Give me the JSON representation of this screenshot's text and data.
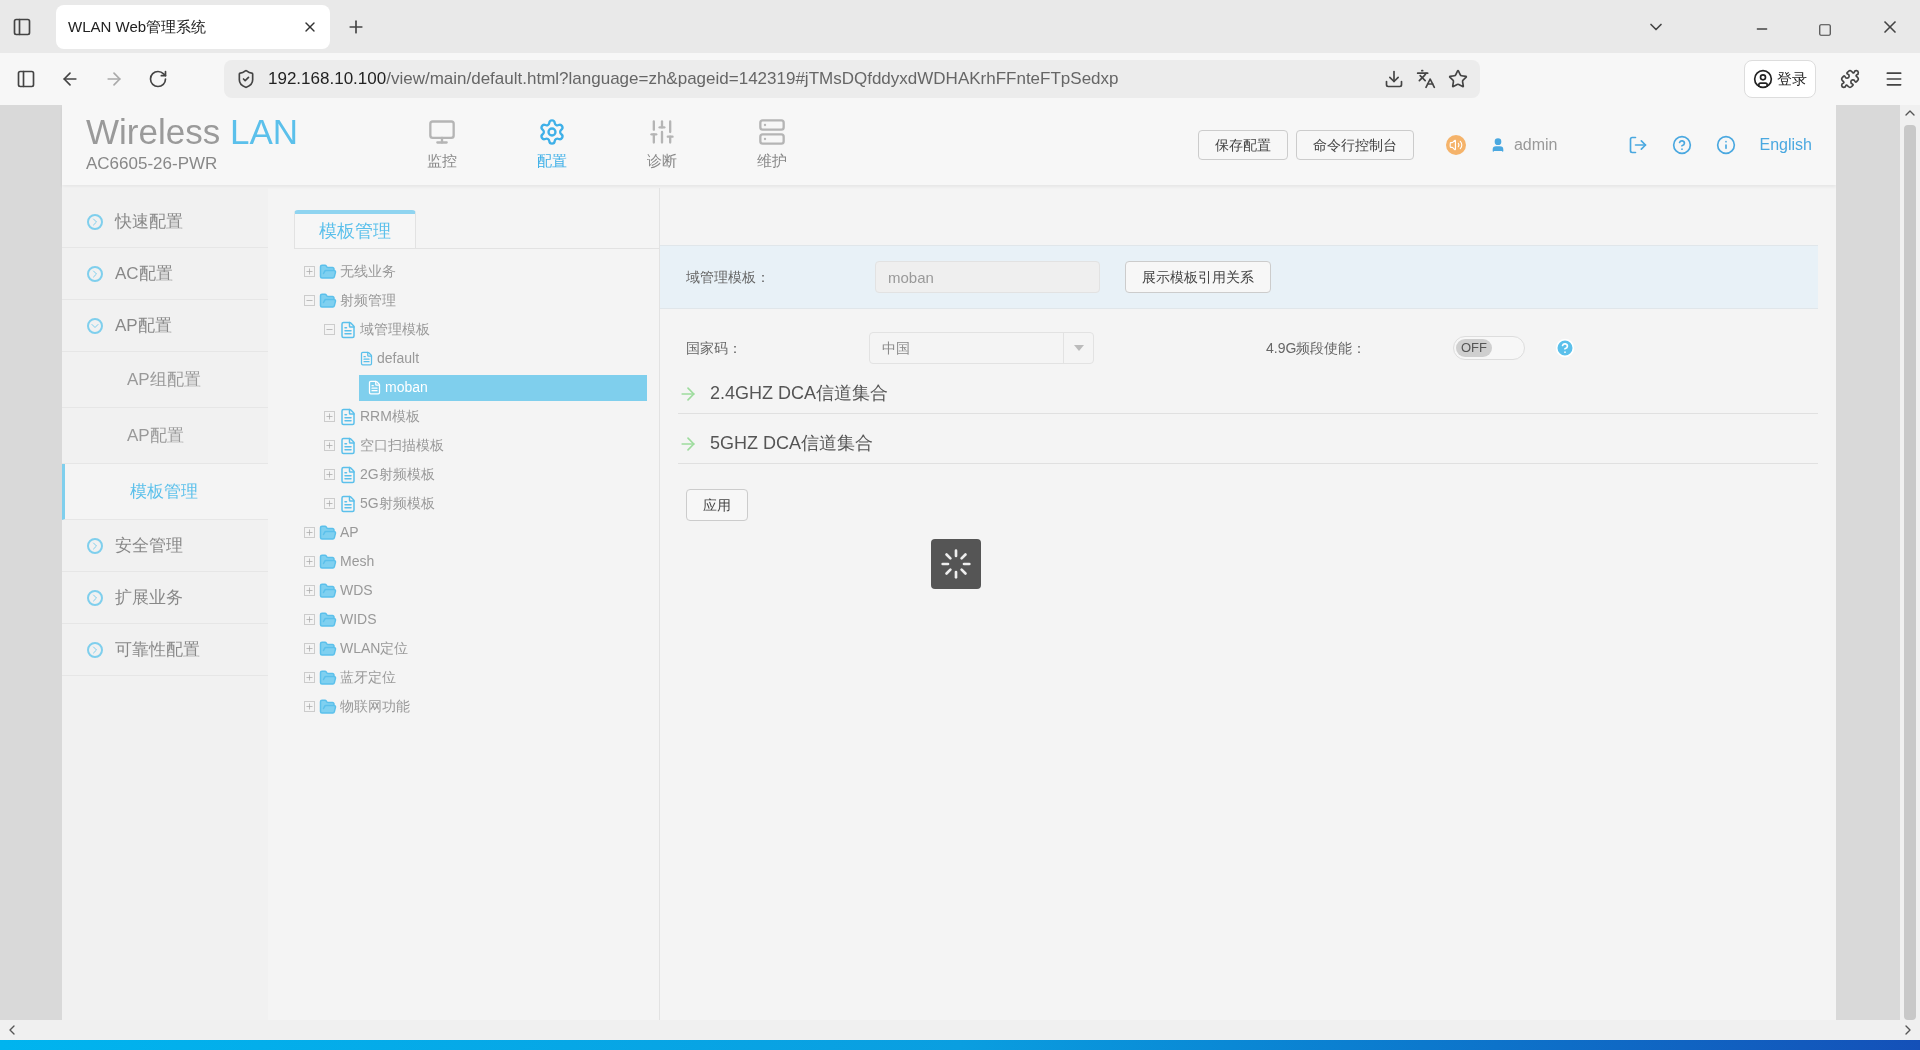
{
  "browser": {
    "tab_title": "WLAN Web管理系统",
    "url_host": "192.168.10.100",
    "url_rest": "/view/main/default.html?language=zh&pageid=142319#jTMsDQfddyxdWDHAKrhFFnteFTpSedxp",
    "sign_in": "登录"
  },
  "header": {
    "brand_first": "Wireless",
    "brand_second": "LAN",
    "model": "AC6605-26-PWR",
    "nav": [
      {
        "label": "监控",
        "kind": "monitor",
        "selected": false
      },
      {
        "label": "配置",
        "kind": "gear",
        "selected": true
      },
      {
        "label": "诊断",
        "kind": "sliders",
        "selected": false
      },
      {
        "label": "维护",
        "kind": "maintain",
        "selected": false
      }
    ],
    "buttons": [
      "保存配置",
      "命令行控制台"
    ],
    "user": "admin",
    "language": "English"
  },
  "sidebar": [
    {
      "label": "快速配置",
      "kind": "group",
      "expanded": false,
      "selected": false
    },
    {
      "label": "AC配置",
      "kind": "group",
      "expanded": false,
      "selected": false
    },
    {
      "label": "AP配置",
      "kind": "group",
      "expanded": true,
      "selected": false
    },
    {
      "label": "AP组配置",
      "kind": "sub",
      "selected": false
    },
    {
      "label": "AP配置",
      "kind": "sub",
      "selected": false
    },
    {
      "label": "模板管理",
      "kind": "sub",
      "selected": true
    },
    {
      "label": "安全管理",
      "kind": "group",
      "expanded": false,
      "selected": false
    },
    {
      "label": "扩展业务",
      "kind": "group",
      "expanded": false,
      "selected": false
    },
    {
      "label": "可靠性配置",
      "kind": "group",
      "expanded": false,
      "selected": false
    }
  ],
  "tabs": [
    {
      "label": "模板管理",
      "selected": true
    }
  ],
  "tree": [
    {
      "label": "无线业务",
      "kind": "folder",
      "expanded": false
    },
    {
      "label": "射频管理",
      "kind": "folder",
      "expanded": true,
      "children": [
        {
          "label": "域管理模板",
          "kind": "template",
          "expanded": true,
          "children": [
            {
              "label": "default",
              "kind": "file",
              "selected": false
            },
            {
              "label": "moban",
              "kind": "file",
              "selected": true
            }
          ]
        },
        {
          "label": "RRM模板",
          "kind": "template",
          "expanded": false
        },
        {
          "label": "空口扫描模板",
          "kind": "template",
          "expanded": false
        },
        {
          "label": "2G射频模板",
          "kind": "template",
          "expanded": false
        },
        {
          "label": "5G射频模板",
          "kind": "template",
          "expanded": false
        }
      ]
    },
    {
      "label": "AP",
      "kind": "folder",
      "expanded": false
    },
    {
      "label": "Mesh",
      "kind": "folder",
      "expanded": false
    },
    {
      "label": "WDS",
      "kind": "folder",
      "expanded": false
    },
    {
      "label": "WIDS",
      "kind": "folder",
      "expanded": false
    },
    {
      "label": "WLAN定位",
      "kind": "folder",
      "expanded": false
    },
    {
      "label": "蓝牙定位",
      "kind": "folder",
      "expanded": false
    },
    {
      "label": "物联网功能",
      "kind": "folder",
      "expanded": false
    }
  ],
  "form": {
    "domain_label": "域管理模板：",
    "domain_value": "moban",
    "domain_disabled": true,
    "relation_button": "展示模板引用关系",
    "country_label": "国家码：",
    "country_value": "中国",
    "band_label": "4.9G频段使能：",
    "band_on": false,
    "band_text": "OFF",
    "sections": [
      "2.4GHZ DCA信道集合",
      "5GHZ DCA信道集合"
    ],
    "apply_button": "应用",
    "loading": true
  }
}
